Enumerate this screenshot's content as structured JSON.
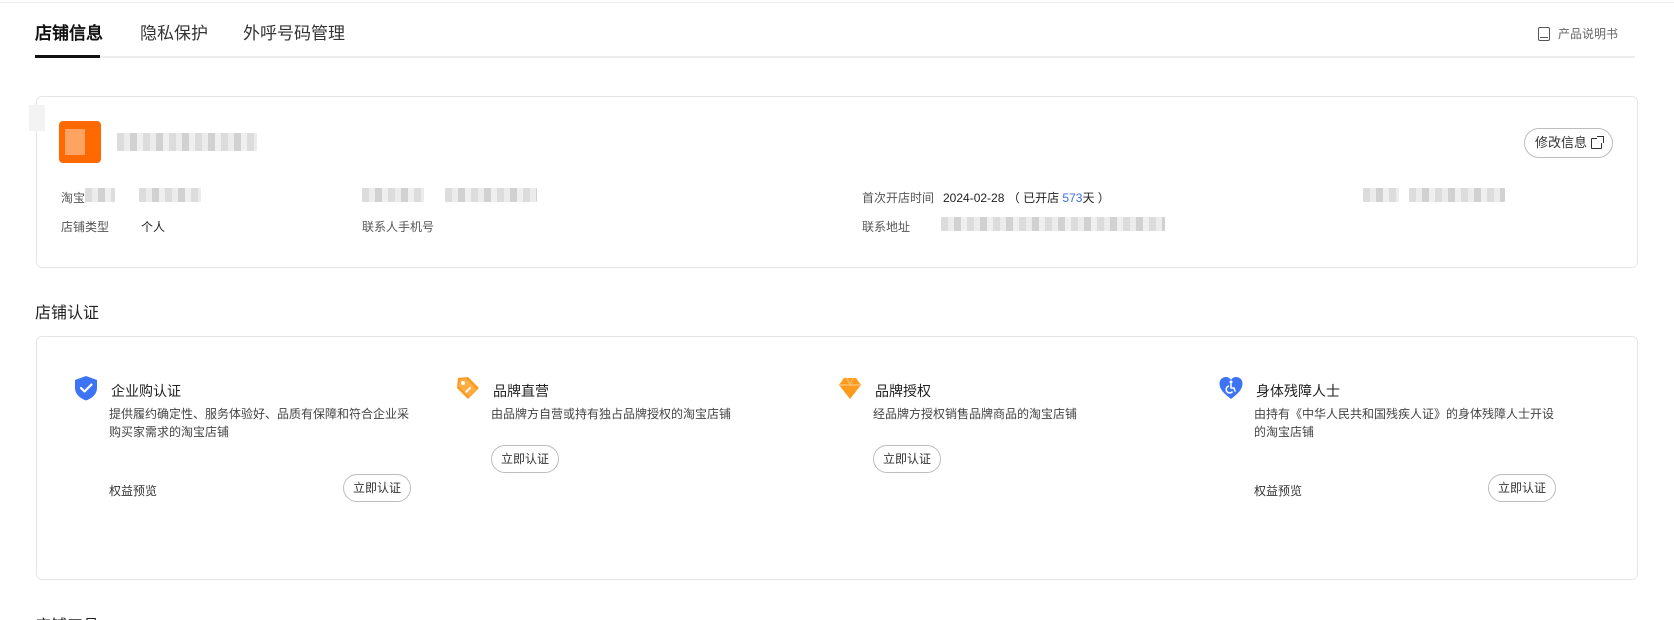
{
  "tabs": [
    {
      "label": "店铺信息"
    },
    {
      "label": "隐私保护"
    },
    {
      "label": "外呼号码管理"
    }
  ],
  "manual_label": "产品说明书",
  "store": {
    "edit_label": "修改信息",
    "taobao_label": "淘宝",
    "first_open_label": "首次开店时间",
    "first_open_date": "2024-02-28",
    "opened_prefix": "（ 已开店",
    "opened_days": "573",
    "opened_suffix": "天 ）",
    "type_label": "店铺类型",
    "type_value": "个人",
    "contact_phone_label": "联系人手机号",
    "address_label": "联系地址"
  },
  "cert_section_title": "店铺认证",
  "tools_section_title": "店铺工具",
  "certs": [
    {
      "name": "企业购认证",
      "desc": "提供履约确定性、服务体验好、品质有保障和符合企业采购买家需求的淘宝店铺",
      "benefit": "权益预览",
      "button": "立即认证",
      "icon": "shield-check-icon",
      "color": "#3d73f5"
    },
    {
      "name": "品牌直营",
      "desc": "由品牌方自营或持有独占品牌授权的淘宝店铺",
      "button": "立即认证",
      "icon": "tag-icon",
      "color": "#ff9a1f"
    },
    {
      "name": "品牌授权",
      "desc": "经品牌方授权销售品牌商品的淘宝店铺",
      "button": "立即认证",
      "icon": "diamond-icon",
      "color": "#ff9a1f"
    },
    {
      "name": "身体残障人士",
      "desc": "由持有《中华人民共和国残疾人证》的身体残障人士开设的淘宝店铺",
      "benefit": "权益预览",
      "button": "立即认证",
      "icon": "heart-accessibility-icon",
      "color": "#3d73f5"
    }
  ]
}
